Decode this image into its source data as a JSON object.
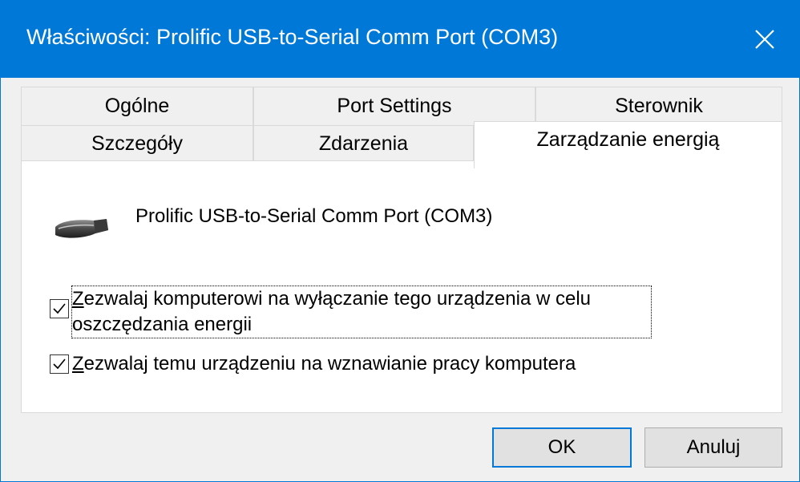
{
  "window": {
    "title": "Właściwości: Prolific USB-to-Serial Comm Port (COM3)"
  },
  "tabs": {
    "row1": [
      "Ogólne",
      "Port Settings",
      "Sterownik"
    ],
    "row2": [
      "Szczegóły",
      "Zdarzenia",
      "Zarządzanie energią"
    ],
    "active": "Zarządzanie energią"
  },
  "panel": {
    "device_name": "Prolific USB-to-Serial Comm Port (COM3)",
    "options": [
      {
        "mnemonic": "Z",
        "line1": "ezwalaj komputerowi na wyłączanie tego urządzenia w celu",
        "line2": "oszczędzania energii",
        "checked": true
      },
      {
        "mnemonic": "Z",
        "line1": "ezwalaj temu urządzeniu na wznawianie pracy komputera",
        "checked": true
      }
    ]
  },
  "buttons": {
    "ok": "OK",
    "cancel": "Anuluj"
  },
  "colors": {
    "titlebar": "#0078d7",
    "focus_border": "#0078d7"
  },
  "icons": {
    "close": "close-icon",
    "device": "serial-port-icon",
    "check": "checkmark-icon"
  }
}
